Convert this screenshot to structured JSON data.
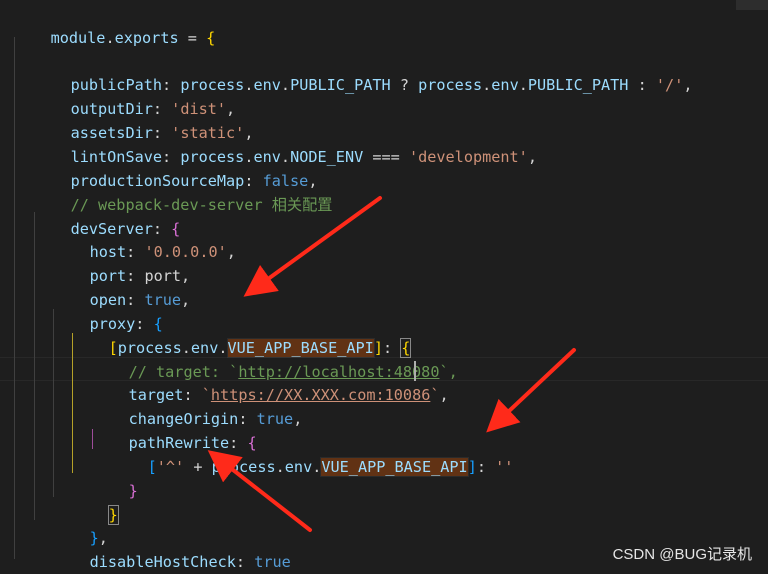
{
  "editor": {
    "watermark": "CSDN @BUG记录机",
    "colors": {
      "background": "#1e1e1e",
      "property": "#9cdcfe",
      "string": "#ce9178",
      "keyword": "#569cd6",
      "comment": "#6a9955",
      "bracket_level_1": "#ffd700",
      "bracket_level_2": "#da70d6",
      "bracket_level_3": "#179fff",
      "find_highlight": "#613214",
      "annotation_arrow": "#ff2a1a"
    },
    "annotations": [
      "red-arrow",
      "red-arrow",
      "red-arrow"
    ],
    "lines": [
      {
        "t1": "module",
        "t2": ".",
        "t3": "exports",
        "t4": " = ",
        "t5": "{"
      },
      {},
      {
        "t1": "publicPath",
        "t2": ": ",
        "t3": "process",
        "t4": ".",
        "t5": "env",
        "t6": ".",
        "t7": "PUBLIC_PATH",
        "t8": " ? ",
        "t9": "process",
        "t10": ".",
        "t11": "env",
        "t12": ".",
        "t13": "PUBLIC_PATH",
        "t14": " : ",
        "t15": "'/'",
        "t16": ","
      },
      {
        "t1": "outputDir",
        "t2": ": ",
        "t3": "'dist'",
        "t4": ","
      },
      {
        "t1": "assetsDir",
        "t2": ": ",
        "t3": "'static'",
        "t4": ","
      },
      {
        "t1": "lintOnSave",
        "t2": ": ",
        "t3": "process",
        "t4": ".",
        "t5": "env",
        "t6": ".",
        "t7": "NODE_ENV",
        "t8": " === ",
        "t9": "'development'",
        "t10": ","
      },
      {
        "t1": "productionSourceMap",
        "t2": ": ",
        "t3": "false",
        "t4": ","
      },
      {
        "t1": "// webpack-dev-server 相关配置"
      },
      {
        "t1": "devServer",
        "t2": ": ",
        "t3": "{"
      },
      {
        "t1": "host",
        "t2": ": ",
        "t3": "'0.0.0.0'",
        "t4": ","
      },
      {
        "t1": "port",
        "t2": ": ",
        "t3": "port",
        "t4": ","
      },
      {
        "t1": "open",
        "t2": ": ",
        "t3": "true",
        "t4": ","
      },
      {
        "t1": "proxy",
        "t2": ": ",
        "t3": "{"
      },
      {
        "t1": "[",
        "t2": "process",
        "t3": ".",
        "t4": "env",
        "t5": ".",
        "t6": "VUE_APP_BASE_API",
        "t7": "]",
        "t8": ": ",
        "t9": "{"
      },
      {
        "t1": "// target: `",
        "t2": "http://localhost:48080",
        "t3": "`,"
      },
      {
        "t1": "target",
        "t2": ": ",
        "t3": "`",
        "t4": "https://XX.XXX.com:10086",
        "t5": "`",
        "t6": ","
      },
      {
        "t1": "changeOrigin",
        "t2": ": ",
        "t3": "true",
        "t4": ","
      },
      {
        "t1": "pathRewrite",
        "t2": ": ",
        "t3": "{"
      },
      {
        "t1": "[",
        "t2": "'^'",
        "t3": " + ",
        "t4": "process",
        "t5": ".",
        "t6": "env",
        "t7": ".",
        "t8": "VUE_APP_BASE_API",
        "t9": "]",
        "t10": ": ",
        "t11": "''"
      },
      {
        "t1": "}"
      },
      {
        "t1": "}"
      },
      {
        "t1": "}",
        "t2": ","
      },
      {
        "t1": "disableHostCheck",
        "t2": ": ",
        "t3": "true"
      },
      {
        "t1": "}",
        "t2": ","
      }
    ]
  }
}
